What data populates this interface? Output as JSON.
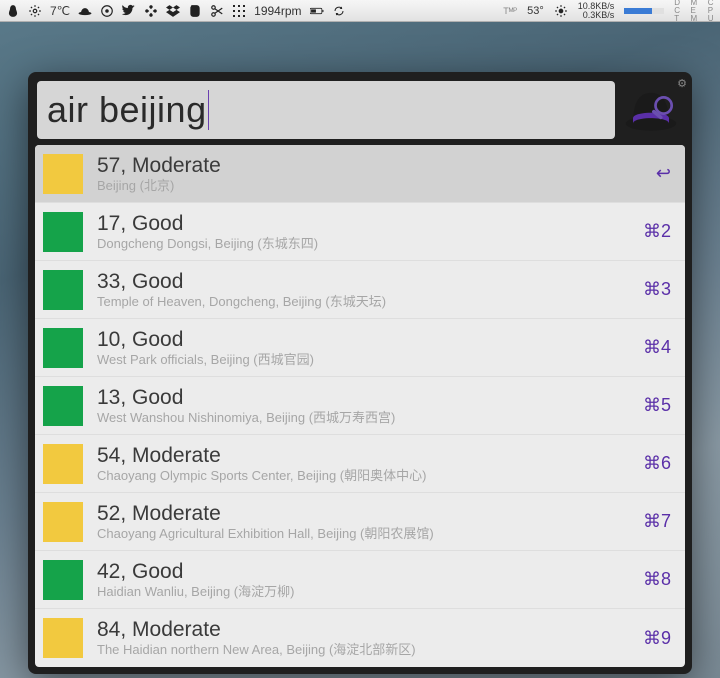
{
  "menubar": {
    "temp_c": "7℃",
    "rpm": "1994rpm",
    "temp_f_label": "Tᴹᴾ",
    "temp_f": "53°",
    "net_down": "10.8KB/s",
    "net_up": "0.3KB/s",
    "col1": [
      "D",
      "C",
      "T"
    ],
    "col2": [
      "M",
      "E",
      "M"
    ],
    "col3": [
      "C",
      "P",
      "U"
    ]
  },
  "search": {
    "query": "air beijing"
  },
  "colors": {
    "good": "#15a34a",
    "moderate": "#f2c93f"
  },
  "results": [
    {
      "value": "57, Moderate",
      "location": "Beijing (北京)",
      "level": "moderate",
      "shortcut": "↩",
      "selected": true
    },
    {
      "value": "17, Good",
      "location": "Dongcheng Dongsi, Beijing (东城东四)",
      "level": "good",
      "shortcut": "⌘2",
      "selected": false
    },
    {
      "value": "33, Good",
      "location": "Temple of Heaven, Dongcheng, Beijing (东城天坛)",
      "level": "good",
      "shortcut": "⌘3",
      "selected": false
    },
    {
      "value": "10, Good",
      "location": "West Park officials, Beijing (西城官园)",
      "level": "good",
      "shortcut": "⌘4",
      "selected": false
    },
    {
      "value": "13, Good",
      "location": "West Wanshou Nishinomiya, Beijing (西城万寿西宫)",
      "level": "good",
      "shortcut": "⌘5",
      "selected": false
    },
    {
      "value": "54, Moderate",
      "location": "Chaoyang Olympic Sports Center, Beijing (朝阳奥体中心)",
      "level": "moderate",
      "shortcut": "⌘6",
      "selected": false
    },
    {
      "value": "52, Moderate",
      "location": "Chaoyang Agricultural Exhibition Hall, Beijing (朝阳农展馆)",
      "level": "moderate",
      "shortcut": "⌘7",
      "selected": false
    },
    {
      "value": "42, Good",
      "location": "Haidian Wanliu, Beijing (海淀万柳)",
      "level": "good",
      "shortcut": "⌘8",
      "selected": false
    },
    {
      "value": "84, Moderate",
      "location": "The Haidian northern New Area, Beijing (海淀北部新区)",
      "level": "moderate",
      "shortcut": "⌘9",
      "selected": false
    }
  ]
}
